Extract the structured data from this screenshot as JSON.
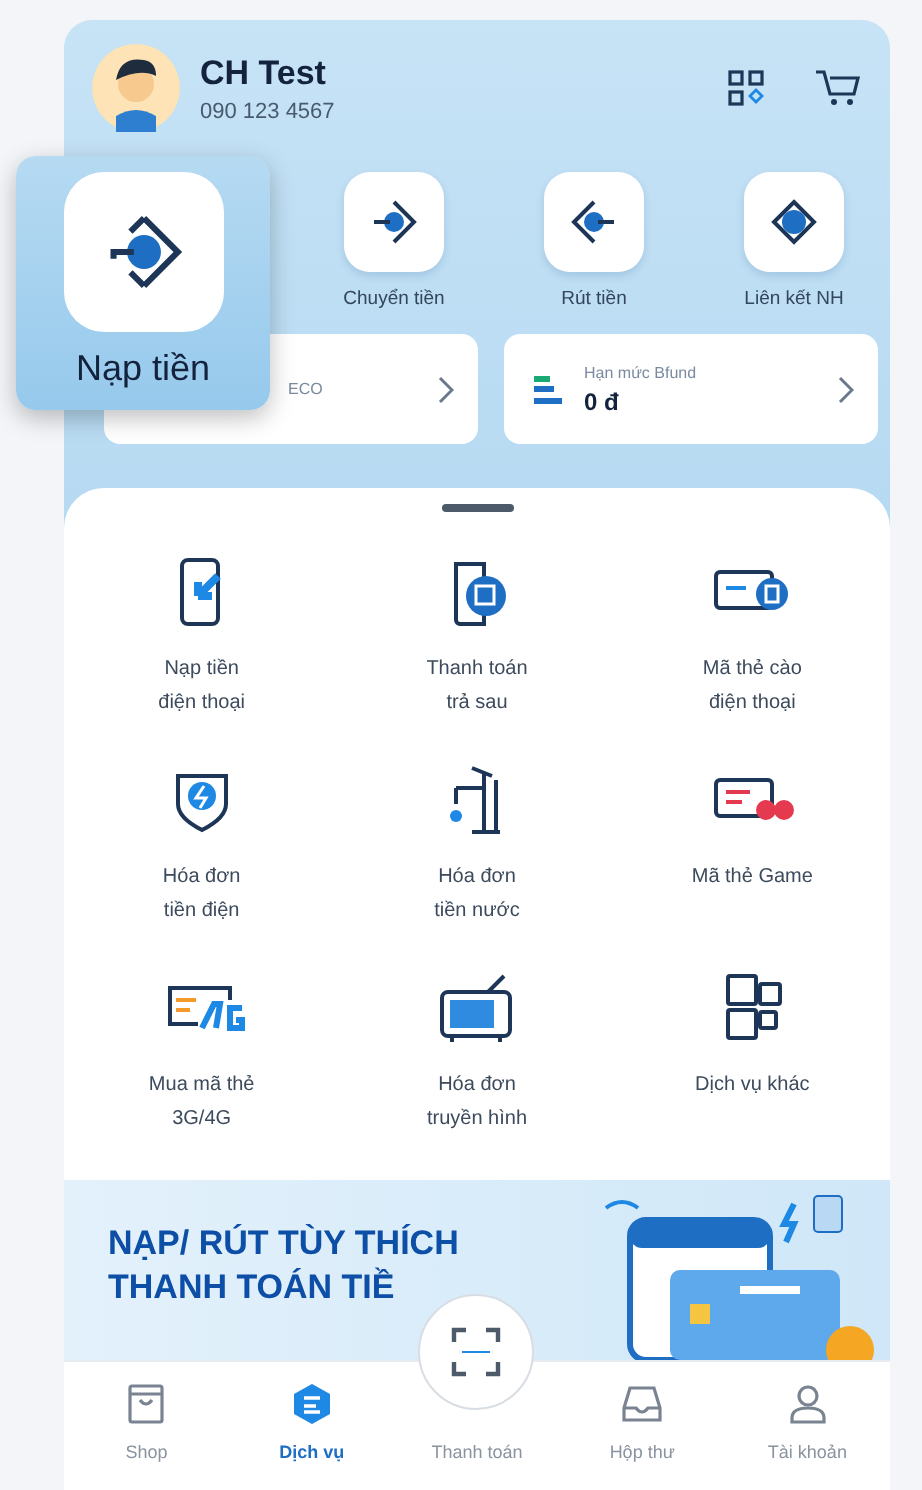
{
  "profile": {
    "name": "CH Test",
    "phone": "090 123 4567"
  },
  "quick_actions": [
    {
      "label": "Chuyển tiền",
      "kind": "transfer"
    },
    {
      "label": "Rút tiền",
      "kind": "withdraw"
    },
    {
      "label": "Liên kết NH",
      "kind": "link"
    }
  ],
  "magnified_action": {
    "label": "Nạp tiền"
  },
  "balances": [
    {
      "label": "ECO"
    },
    {
      "label": "Hạn mức Bfund",
      "amount": "0 đ",
      "kind": "fund"
    }
  ],
  "services": [
    {
      "label": "Nạp tiền\nđiện thoại",
      "kind": "phone"
    },
    {
      "label": "Thanh toán\ntrả sau",
      "kind": "postpaid"
    },
    {
      "label": "Mã thẻ cào\nđiện thoại",
      "kind": "card"
    },
    {
      "label": "Hóa đơn\ntiền điện",
      "kind": "power"
    },
    {
      "label": "Hóa đơn\ntiền nước",
      "kind": "water"
    },
    {
      "label": "Mã thẻ Game",
      "kind": "game"
    },
    {
      "label": "Mua mã thẻ\n3G/4G",
      "kind": "data"
    },
    {
      "label": "Hóa đơn\ntruyền hình",
      "kind": "tv"
    },
    {
      "label": "Dịch vụ khác",
      "kind": "more"
    }
  ],
  "banner": {
    "line1": "NẠP/ RÚT TÙY THÍCH",
    "line2": "THANH TOÁN TIỀ"
  },
  "nav": [
    {
      "label": "Shop",
      "kind": "shop",
      "selected": false
    },
    {
      "label": "Dịch vụ",
      "kind": "service",
      "selected": true
    },
    {
      "label": "Thanh toán",
      "kind": "scan",
      "selected": false
    },
    {
      "label": "Hộp thư",
      "kind": "inbox",
      "selected": false
    },
    {
      "label": "Tài khoản",
      "kind": "account",
      "selected": false
    }
  ]
}
